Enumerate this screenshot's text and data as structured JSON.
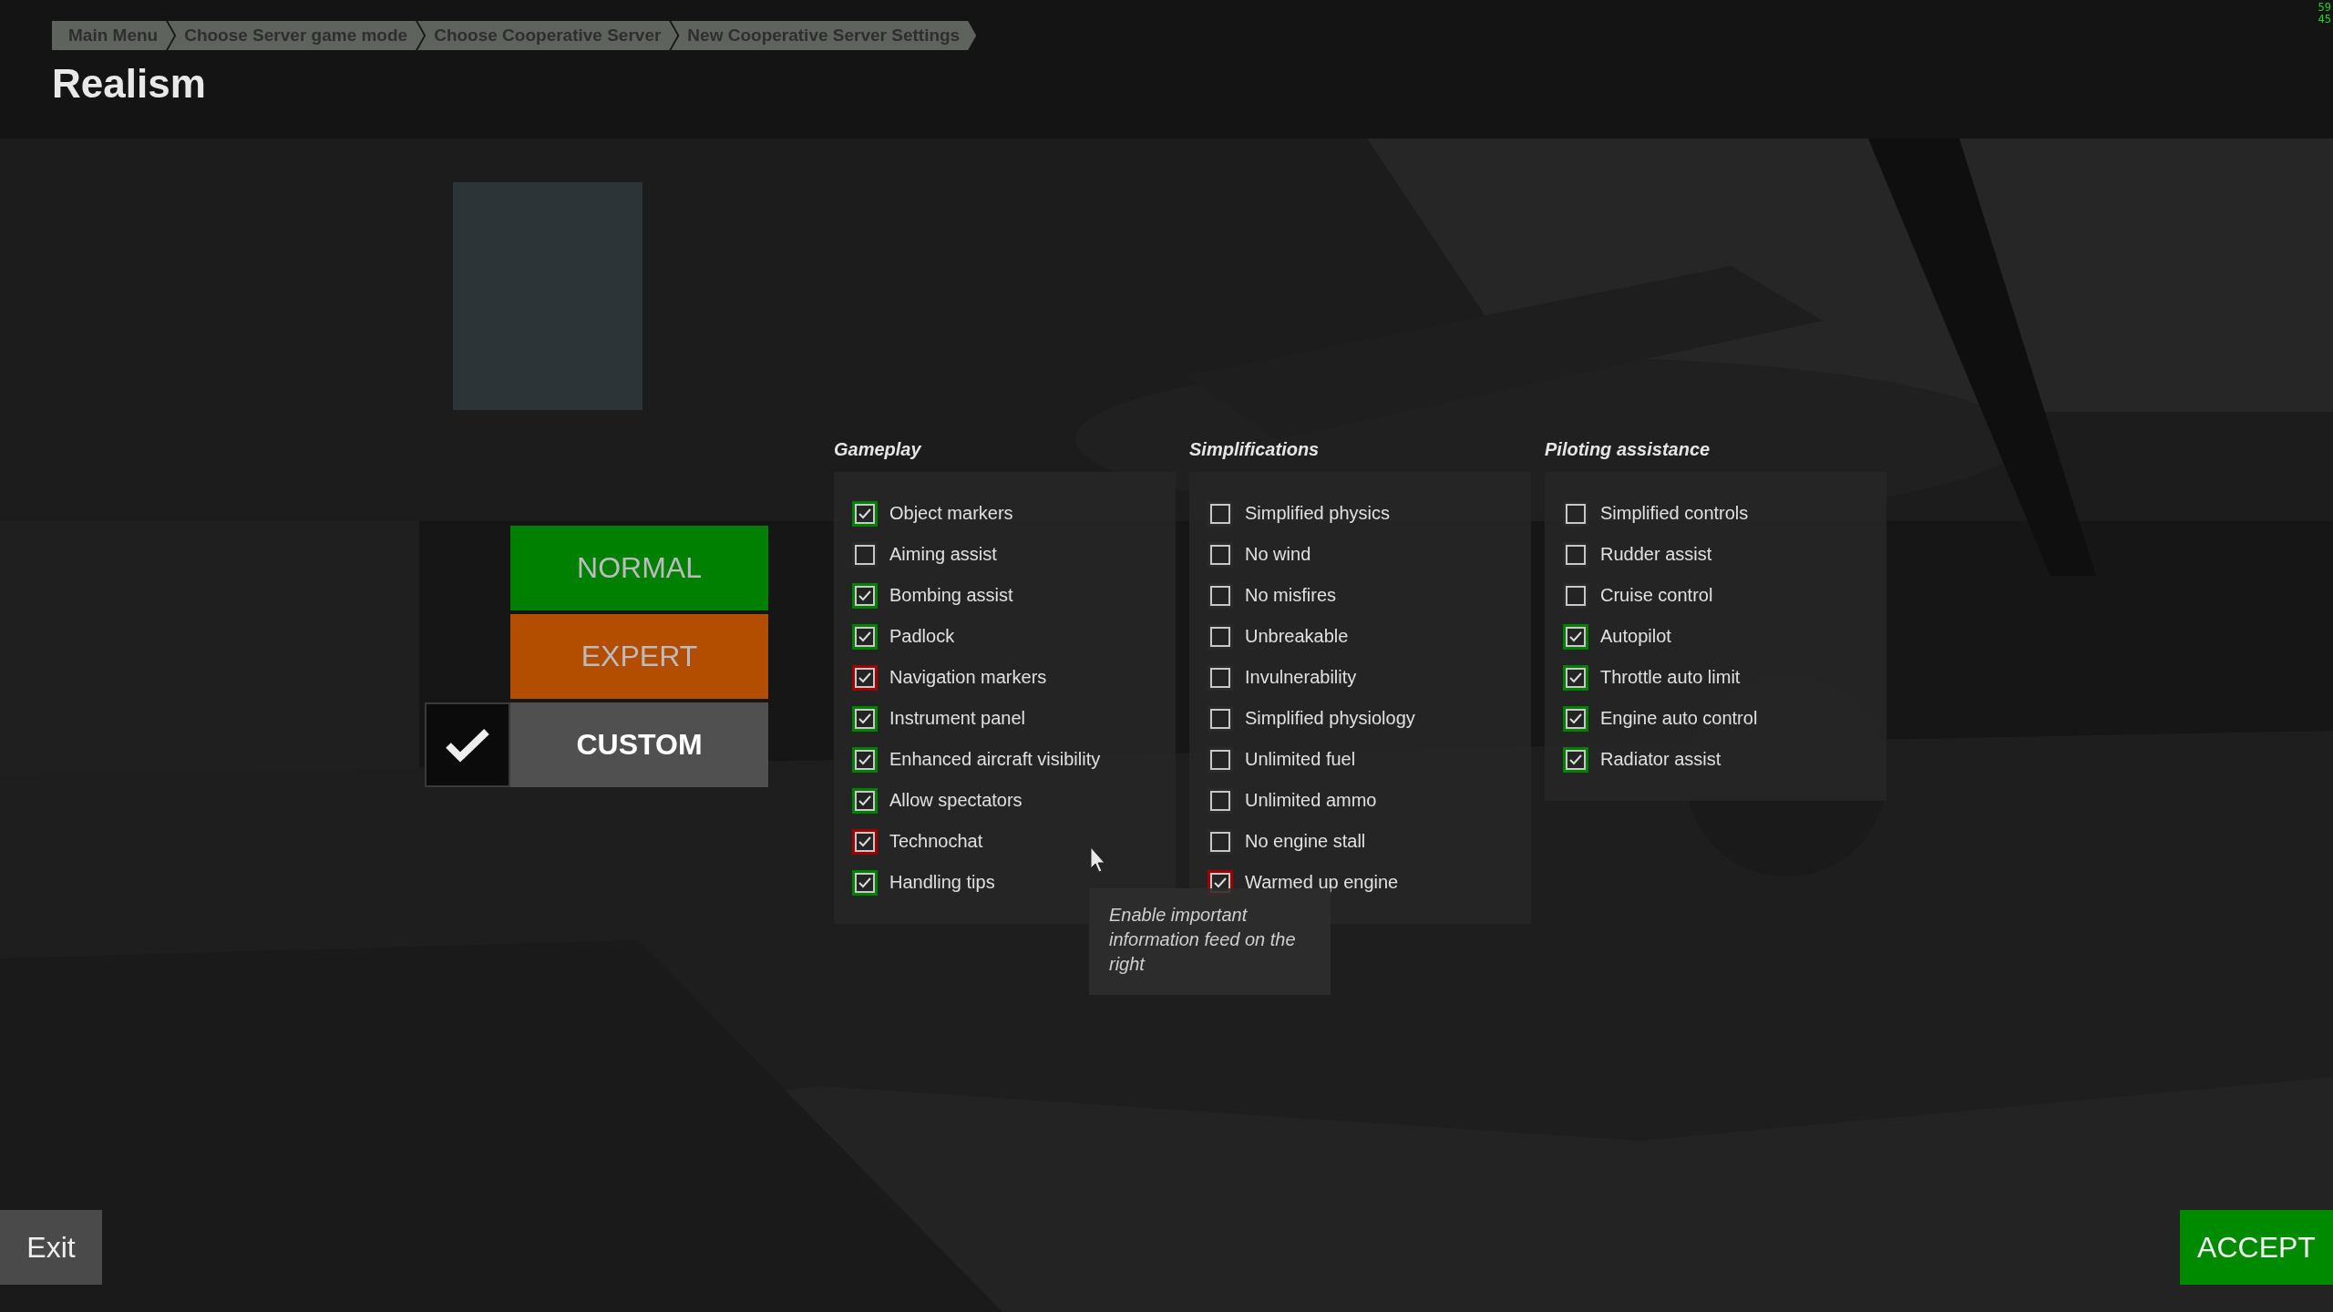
{
  "breadcrumb": [
    "Main Menu",
    "Choose Server game mode",
    "Choose Cooperative Server",
    "New Cooperative Server Settings"
  ],
  "title": "Realism",
  "fps_counter": [
    "59",
    "45"
  ],
  "presets": [
    {
      "label": "NORMAL",
      "color": "#008000",
      "selected": false
    },
    {
      "label": "EXPERT",
      "color": "#b34d00",
      "selected": false
    },
    {
      "label": "CUSTOM",
      "color": "#505050",
      "selected": true
    }
  ],
  "groups": [
    {
      "title": "Gameplay",
      "items": [
        {
          "label": "Object markers",
          "checked": true,
          "color": "#008000"
        },
        {
          "label": "Aiming assist",
          "checked": false
        },
        {
          "label": "Bombing assist",
          "checked": true,
          "color": "#008000"
        },
        {
          "label": "Padlock",
          "checked": true,
          "color": "#008000"
        },
        {
          "label": "Navigation markers",
          "checked": true,
          "color": "#a00000"
        },
        {
          "label": "Instrument panel",
          "checked": true,
          "color": "#008000"
        },
        {
          "label": "Enhanced aircraft visibility",
          "checked": true,
          "color": "#008000"
        },
        {
          "label": "Allow spectators",
          "checked": true,
          "color": "#008000"
        },
        {
          "label": "Technochat",
          "checked": true,
          "color": "#a00000"
        },
        {
          "label": "Handling tips",
          "checked": true,
          "color": "#008000"
        }
      ]
    },
    {
      "title": "Simplifications",
      "items": [
        {
          "label": "Simplified physics",
          "checked": false
        },
        {
          "label": "No wind",
          "checked": false
        },
        {
          "label": "No misfires",
          "checked": false
        },
        {
          "label": "Unbreakable",
          "checked": false
        },
        {
          "label": "Invulnerability",
          "checked": false
        },
        {
          "label": "Simplified physiology",
          "checked": false
        },
        {
          "label": "Unlimited fuel",
          "checked": false
        },
        {
          "label": "Unlimited ammo",
          "checked": false
        },
        {
          "label": "No engine stall",
          "checked": false
        },
        {
          "label": "Warmed up engine",
          "checked": true,
          "color": "#a00000"
        }
      ]
    },
    {
      "title": "Piloting assistance",
      "items": [
        {
          "label": "Simplified controls",
          "checked": false
        },
        {
          "label": "Rudder assist",
          "checked": false
        },
        {
          "label": "Cruise control",
          "checked": false
        },
        {
          "label": "Autopilot",
          "checked": true,
          "color": "#008000"
        },
        {
          "label": "Throttle auto limit",
          "checked": true,
          "color": "#008000"
        },
        {
          "label": "Engine auto control",
          "checked": true,
          "color": "#008000"
        },
        {
          "label": "Radiator assist",
          "checked": true,
          "color": "#008000"
        }
      ]
    }
  ],
  "tooltip": {
    "text": "Enable important information feed on the right"
  },
  "exit_button": "Exit",
  "accept_button": "ACCEPT"
}
